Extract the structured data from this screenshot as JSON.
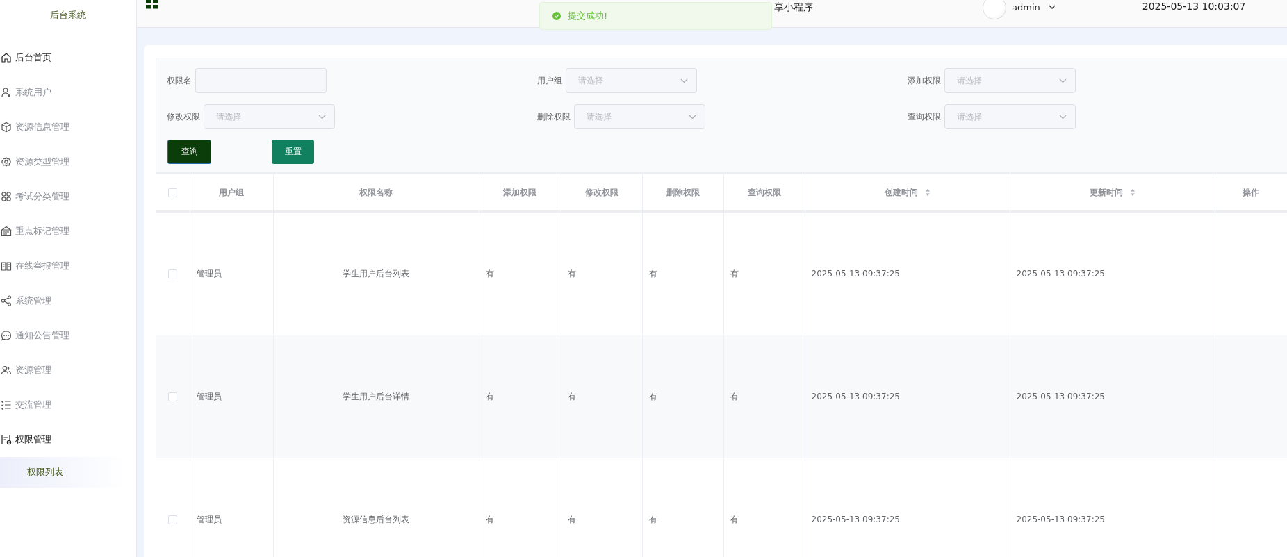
{
  "sidebar": {
    "title": "后台系统",
    "items": [
      {
        "label": "后台首页",
        "kind": "link"
      },
      {
        "label": "系统用户",
        "kind": "submenu",
        "expanded": false
      },
      {
        "label": "资源信息管理",
        "kind": "submenu",
        "expanded": false
      },
      {
        "label": "资源类型管理",
        "kind": "submenu",
        "expanded": false
      },
      {
        "label": "考试分类管理",
        "kind": "submenu",
        "expanded": false
      },
      {
        "label": "重点标记管理",
        "kind": "submenu",
        "expanded": false
      },
      {
        "label": "在线举报管理",
        "kind": "submenu",
        "expanded": false
      },
      {
        "label": "系统管理",
        "kind": "submenu",
        "expanded": false
      },
      {
        "label": "通知公告管理",
        "kind": "submenu",
        "expanded": false
      },
      {
        "label": "资源管理",
        "kind": "submenu",
        "expanded": false
      },
      {
        "label": "交流管理",
        "kind": "submenu",
        "expanded": false
      },
      {
        "label": "权限管理",
        "kind": "submenu",
        "expanded": true,
        "children": [
          {
            "label": "权限列表",
            "selected": true
          }
        ]
      }
    ]
  },
  "header": {
    "title": "享小程序",
    "user": "admin",
    "datetime": "2025-05-13 10:03:07"
  },
  "toast": {
    "kind": "success",
    "text": "提交成功!"
  },
  "filters": [
    {
      "label": "权限名",
      "kind": "input"
    },
    {
      "label": "用户组",
      "kind": "select",
      "placeholder": "请选择"
    },
    {
      "label": "添加权限",
      "kind": "select",
      "placeholder": "请选择"
    },
    {
      "label": "修改权限",
      "kind": "select",
      "placeholder": "请选择"
    },
    {
      "label": "删除权限",
      "kind": "select",
      "placeholder": "请选择"
    },
    {
      "label": "查询权限",
      "kind": "select",
      "placeholder": "请选择"
    }
  ],
  "buttons": [
    {
      "label": "查询",
      "kind": "primary"
    },
    {
      "label": "重置",
      "kind": "secondary"
    }
  ],
  "table": {
    "select_all_checked": false,
    "columns": [
      {
        "label": "用户组",
        "sortable": false
      },
      {
        "label": "权限名称",
        "sortable": false
      },
      {
        "label": "添加权限",
        "sortable": false
      },
      {
        "label": "修改权限",
        "sortable": false
      },
      {
        "label": "删除权限",
        "sortable": false
      },
      {
        "label": "查询权限",
        "sortable": false
      },
      {
        "label": "创建时间",
        "sortable": true
      },
      {
        "label": "更新时间",
        "sortable": true
      },
      {
        "label": "操作",
        "sortable": false
      }
    ],
    "rows": [
      {
        "checked": false,
        "cells": [
          "管理员",
          "学生用户后台列表",
          "有",
          "有",
          "有",
          "有",
          "2025-05-13 09:37:25",
          "2025-05-13 09:37:25"
        ]
      },
      {
        "checked": false,
        "cells": [
          "管理员",
          "学生用户后台详情",
          "有",
          "有",
          "有",
          "有",
          "2025-05-13 09:37:25",
          "2025-05-13 09:37:25"
        ]
      },
      {
        "checked": false,
        "cells": [
          "管理员",
          "资源信息后台列表",
          "有",
          "有",
          "有",
          "有",
          "2025-05-13 09:37:25",
          "2025-05-13 09:37:25"
        ]
      }
    ]
  }
}
